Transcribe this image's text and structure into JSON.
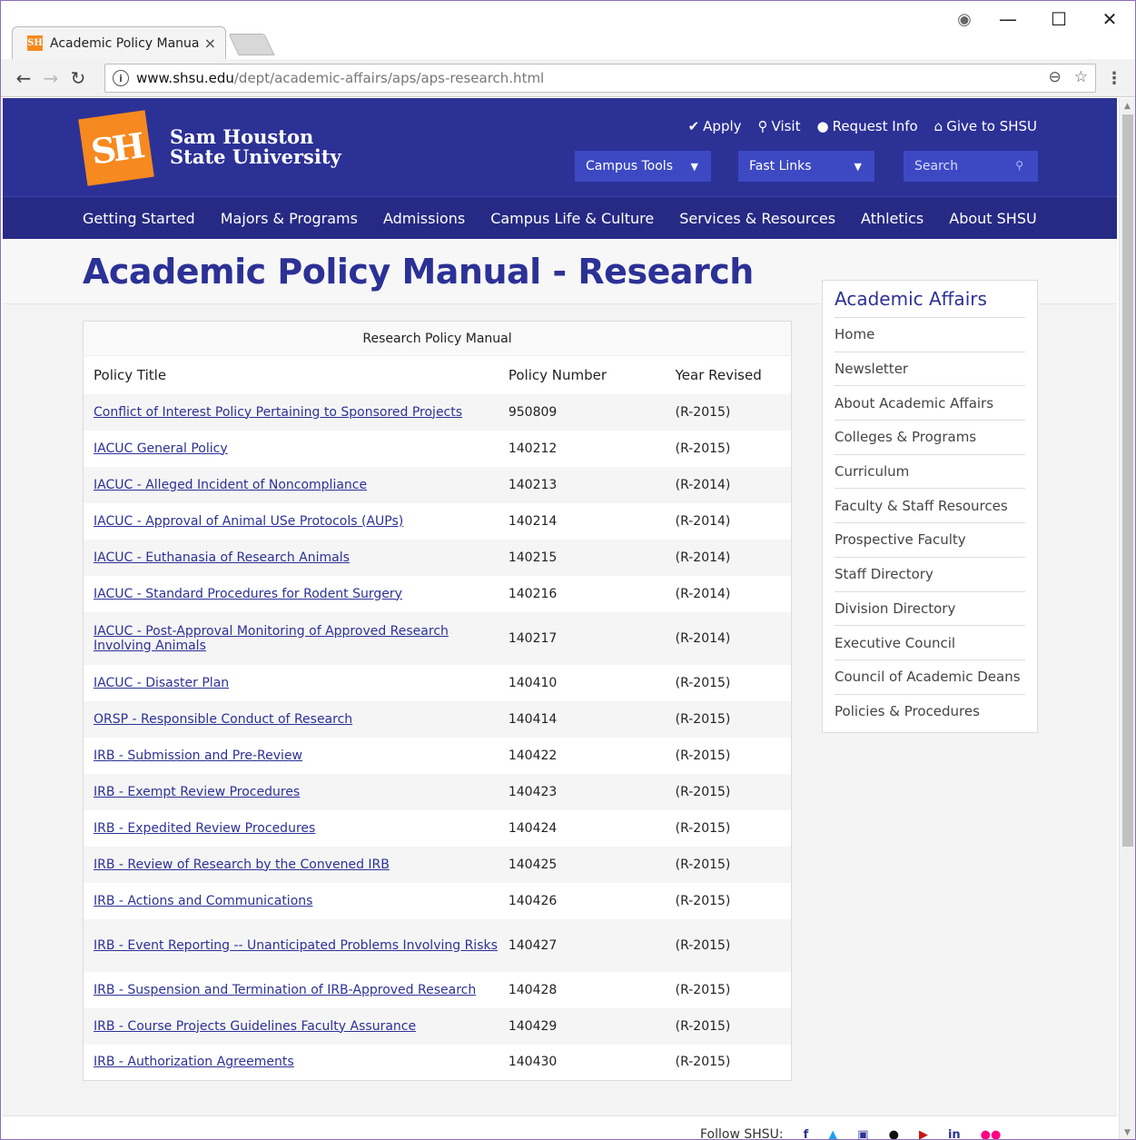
{
  "browser": {
    "tab_title": "Academic Policy Manual",
    "tab_close": "×",
    "url_host": "www.shsu.edu",
    "url_path": "/dept/academic-affairs/aps/aps-research.html",
    "window_controls": {
      "minimize": "—",
      "maximize": "☐",
      "close": "✕"
    }
  },
  "header": {
    "logo_mark": "SH",
    "logo_line1": "Sam Houston",
    "logo_line2": "State University",
    "util_links": [
      {
        "icon": "✔",
        "label": "Apply"
      },
      {
        "icon": "⚲",
        "label": "Visit"
      },
      {
        "icon": "●",
        "label": "Request Info"
      },
      {
        "icon": "⌂",
        "label": "Give to SHSU"
      }
    ],
    "campus_tools": "Campus Tools",
    "fast_links": "Fast Links",
    "search_placeholder": "Search"
  },
  "nav": [
    "Getting Started",
    "Majors & Programs",
    "Admissions",
    "Campus Life & Culture",
    "Services & Resources",
    "Athletics",
    "About SHSU"
  ],
  "page_title": "Academic Policy Manual - Research",
  "table": {
    "caption": "Research Policy Manual",
    "headers": [
      "Policy Title",
      "Policy Number",
      "Year Revised"
    ],
    "rows": [
      [
        "Conflict of Interest Policy Pertaining to Sponsored Projects",
        "950809",
        "(R-2015)"
      ],
      [
        "IACUC General Policy",
        "140212",
        "(R-2015)"
      ],
      [
        "IACUC - Alleged Incident of Noncompliance",
        "140213",
        "(R-2014)"
      ],
      [
        "IACUC - Approval of Animal USe Protocols (AUPs)",
        "140214",
        "(R-2014)"
      ],
      [
        "IACUC - Euthanasia of Research Animals",
        "140215",
        "(R-2014)"
      ],
      [
        "IACUC - Standard Procedures for Rodent Surgery",
        "140216",
        "(R-2014)"
      ],
      [
        "IACUC - Post-Approval Monitoring of Approved Research Involving Animals",
        "140217",
        "(R-2014)"
      ],
      [
        "IACUC - Disaster Plan",
        "140410",
        "(R-2015)"
      ],
      [
        "ORSP - Responsible Conduct of Research",
        "140414",
        "(R-2015)"
      ],
      [
        "IRB - Submission and Pre-Review",
        "140422",
        "(R-2015)"
      ],
      [
        "IRB - Exempt Review Procedures",
        "140423",
        "(R-2015)"
      ],
      [
        "IRB - Expedited Review Procedures",
        "140424",
        "(R-2015)"
      ],
      [
        "IRB - Review of Research by the Convened IRB",
        "140425",
        "(R-2015)"
      ],
      [
        "IRB - Actions and Communications",
        "140426",
        "(R-2015)"
      ],
      [
        "IRB - Event Reporting -- Unanticipated Problems Involving Risks",
        "140427",
        "(R-2015)"
      ],
      [
        "IRB - Suspension and Termination of IRB-Approved Research",
        "140428",
        "(R-2015)"
      ],
      [
        "IRB - Course Projects Guidelines Faculty Assurance",
        "140429",
        "(R-2015)"
      ],
      [
        "IRB - Authorization Agreements",
        "140430",
        "(R-2015)"
      ]
    ]
  },
  "sidebar": {
    "title": "Academic Affairs",
    "items": [
      "Home",
      "Newsletter",
      "About Academic Affairs",
      "Colleges & Programs",
      "Curriculum",
      "Faculty & Staff Resources",
      "Prospective Faculty",
      "Staff Directory",
      "Division Directory",
      "Executive Council",
      "Council of Academic Deans",
      "Policies & Procedures"
    ]
  },
  "footer": {
    "follow_label": "Follow SHSU:",
    "socials": [
      "f",
      "t",
      "ig",
      "sc",
      "yt",
      "in",
      "fl"
    ]
  },
  "colors": {
    "brand_blue": "#2c3196",
    "brand_orange": "#f6891f",
    "nav_dark": "#262a84"
  }
}
